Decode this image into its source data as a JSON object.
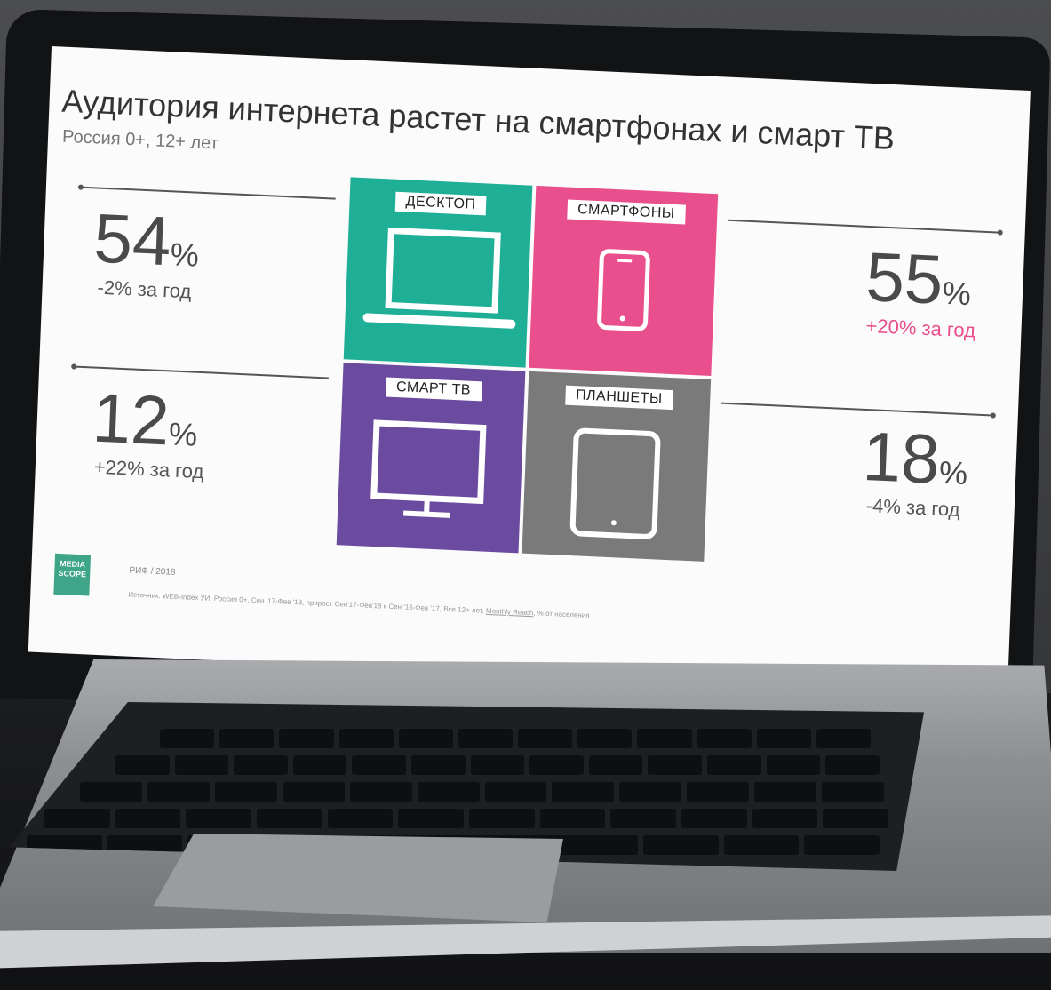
{
  "slide": {
    "title": "Аудитория интернета растет на смартфонах и смарт ТВ",
    "subtitle": "Россия 0+, 12+ лет",
    "stats": {
      "desktop": {
        "value": "54",
        "unit": "%",
        "change": "-2% за год"
      },
      "smart_tv": {
        "value": "12",
        "unit": "%",
        "change": "+22% за год"
      },
      "smartphones": {
        "value": "55",
        "unit": "%",
        "change": "+20% за год"
      },
      "tablets": {
        "value": "18",
        "unit": "%",
        "change": "-4% за год"
      }
    },
    "tiles": {
      "desktop": {
        "label": "ДЕСКТОП",
        "color": "#1faf96",
        "icon": "laptop-icon"
      },
      "smartphones": {
        "label": "СМАРТФОНЫ",
        "color": "#e94f8d",
        "icon": "smartphone-icon"
      },
      "smart_tv": {
        "label": "СМАРТ ТВ",
        "color": "#6a4b9f",
        "icon": "monitor-icon"
      },
      "tablets": {
        "label": "ПЛАНШЕТЫ",
        "color": "#7a7a7a",
        "icon": "tablet-icon"
      }
    },
    "accent_color": "#e94f8d",
    "logo": {
      "line1": "MEDIA",
      "line2": "SCOPE"
    },
    "footer": {
      "rif": "РИФ / 2018",
      "source": "Источник: WEB-Index УИ, Россия 0+, Сен '17-Фев '18, прирост Сен'17-Фев'18 к Сен '16-Фев '17, Все 12+ лет, ",
      "source_link": "Monthly Reach",
      "source_tail": ", % от населения"
    }
  }
}
